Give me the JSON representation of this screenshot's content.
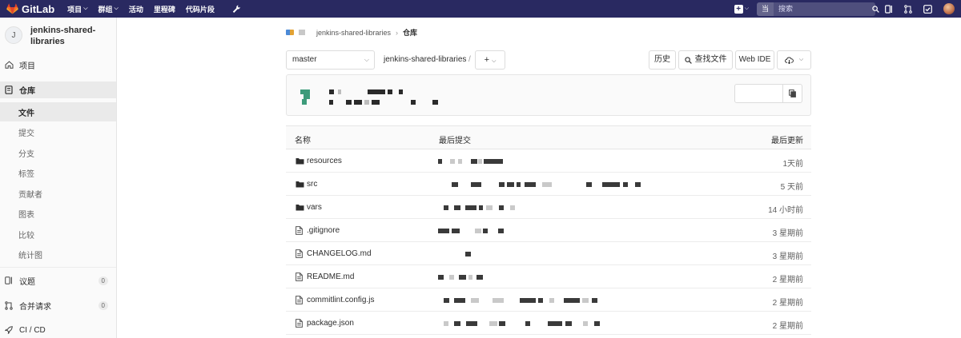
{
  "topbar": {
    "brand": "GitLab",
    "nav": [
      "项目",
      "群组",
      "活动",
      "里程碑",
      "代码片段"
    ],
    "scope": "当前项目",
    "search_placeholder": "搜索"
  },
  "sidebar": {
    "avatar_letter": "J",
    "project_name": "jenkins-shared-libraries",
    "project_label": "项目",
    "repo_label": "仓库",
    "repo_items": [
      "文件",
      "提交",
      "分支",
      "标签",
      "贡献者",
      "图表",
      "比较",
      "统计图"
    ],
    "issues_label": "议题",
    "issues_count": "0",
    "mr_label": "合并请求",
    "mr_count": "0",
    "cicd_label": "CI / CD"
  },
  "breadcrumb": {
    "project": "jenkins-shared-libraries",
    "current": "仓库"
  },
  "toolbar": {
    "branch": "master",
    "path": "jenkins-shared-libraries",
    "path_sep": "/",
    "add": "+",
    "history": "历史",
    "find_file": "查找文件",
    "web_ide": "Web IDE"
  },
  "table": {
    "col_name": "名称",
    "col_commit": "最后提交",
    "col_updated": "最后更新",
    "rows": [
      {
        "name": "resources",
        "type": "folder",
        "updated": "1天前"
      },
      {
        "name": "src",
        "type": "folder",
        "updated": "5 天前"
      },
      {
        "name": "vars",
        "type": "folder",
        "updated": "14 小时前"
      },
      {
        "name": ".gitignore",
        "type": "file",
        "updated": "3 星期前"
      },
      {
        "name": "CHANGELOG.md",
        "type": "file",
        "updated": "3 星期前"
      },
      {
        "name": "README.md",
        "type": "file",
        "updated": "2 星期前"
      },
      {
        "name": "commitlint.config.js",
        "type": "file",
        "updated": "2 星期前"
      },
      {
        "name": "package.json",
        "type": "file",
        "updated": "2 星期前"
      }
    ]
  },
  "colors": {
    "navbar": "#292961",
    "logo": "#e24329",
    "commit_avatar": "#3d9b7a"
  }
}
